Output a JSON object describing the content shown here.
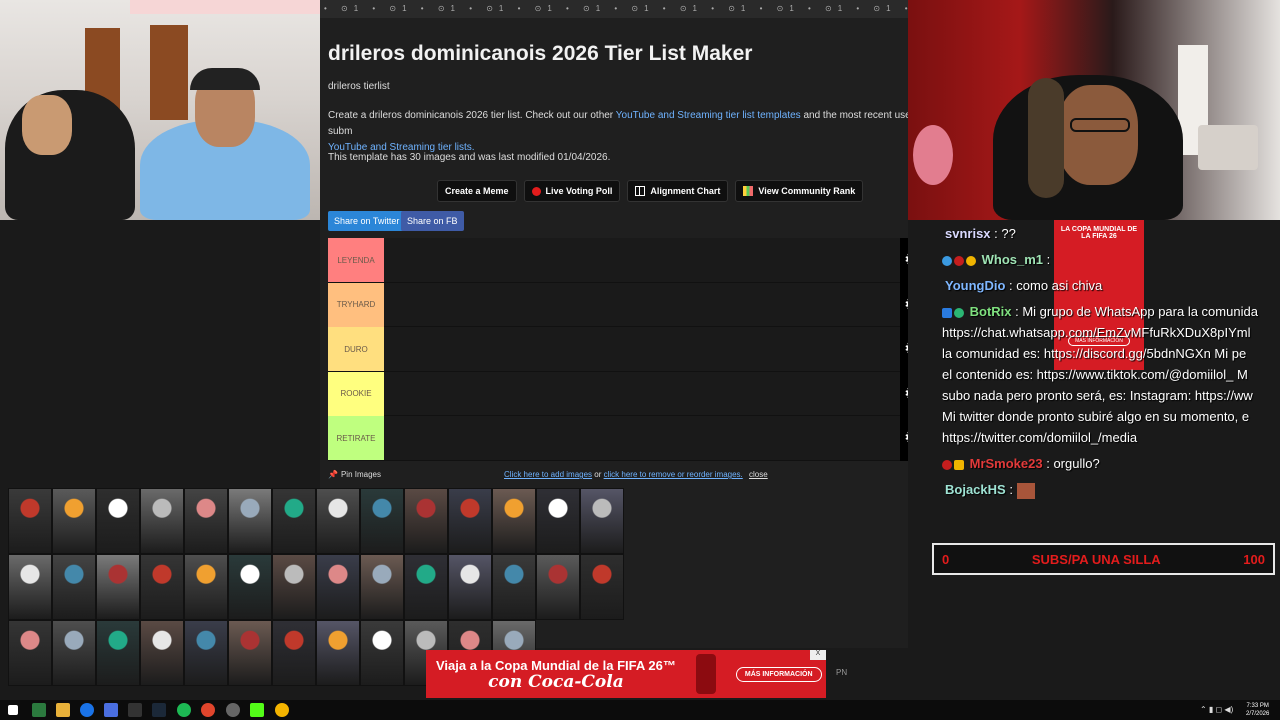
{
  "ad_strip": "• ⊙1 • ⊙1 • ⊙1 • ⊙1 • ⊙1 • ⊙1 • ⊙1 • ⊙1 • ⊙1 • ⊙1 • ⊙1 • ⊙1 • ⊙1 • ⊙1 • ⊙1 • ⊙1 • ⊙1 • ⊙1",
  "page": {
    "title": "drileros dominicanois 2026 Tier List Maker",
    "subtitle": "drileros tierlist",
    "desc_pre": "Create a drileros dominicanois 2026 tier list. Check out our other ",
    "desc_link1": "YouTube and Streaming tier list templates",
    "desc_mid": " and the most recent user subm",
    "desc_link2": "YouTube and Streaming tier lists.",
    "meta": "This template has 30 images and was last modified 01/04/2026."
  },
  "buttons": {
    "meme": "Create a Meme",
    "poll": "Live Voting Poll",
    "alignment": "Alignment Chart",
    "community": "View Community Rank"
  },
  "share": {
    "twitter": "Share on Twitter",
    "fb": "Share on FB"
  },
  "tiers": [
    {
      "label": "LEYENDA",
      "color": "#ff7f7f"
    },
    {
      "label": "TRYHARD",
      "color": "#ffbf7f"
    },
    {
      "label": "DURO",
      "color": "#ffdf7f"
    },
    {
      "label": "ROOKIE",
      "color": "#ffff7f"
    },
    {
      "label": "RETIRATE",
      "color": "#bfff7f"
    }
  ],
  "pin": {
    "label": "Pin Images",
    "add": "Click here to add images",
    "or": " or ",
    "remove": "click here to remove or reorder images.",
    "close": "close"
  },
  "chat": {
    "l1_user": "svnrisx",
    "l1_text": " : ??",
    "l2_user": "Whos_m1",
    "l2_text": " :",
    "l3_user": "YoungDio",
    "l3_text": " : como asi chiva",
    "l4_user": "BotRix",
    "l4_text": " : Mi grupo de WhatsApp para la comunida",
    "l5": "https://chat.whatsapp.com/EmZvMFfuRkXDuX8pIYml",
    "l6": "la comunidad es: https://discord.gg/5bdnNGXn Mi pe",
    "l7": "el contenido es: https://www.tiktok.com/@domiilol_ M",
    "l8": "subo nada pero pronto será, es: Instagram: https://ww",
    "l9": "Mi twitter donde pronto subiré algo en su momento, e",
    "l10": "https://twitter.com/domiilol_/media",
    "l11_user": "MrSmoke23",
    "l11_text": " : orgullo?",
    "l12_user": "BojackHS",
    "l12_text": " :"
  },
  "chat_ad": {
    "text": "LA COPA MUNDIAL DE LA FIFA 26",
    "cta": "MÁS INFORMACIÓN"
  },
  "goal": {
    "left": "0",
    "label": "SUBS/PA UNA SILLA",
    "right": "100"
  },
  "bottom_ad": {
    "line1": "Viaja a la Copa Mundial de la FIFA 26™",
    "line2": "con Coca-Cola",
    "cta": "MÁS INFORMACIÓN",
    "close": "X",
    "pn": "PN"
  },
  "taskbar": {
    "time": "7:33 PM",
    "date": "2/7/2026"
  },
  "colors": {
    "accent_link": "#6fb3ff",
    "goal_red": "#e31c1c",
    "coke_red": "#d51c24"
  }
}
